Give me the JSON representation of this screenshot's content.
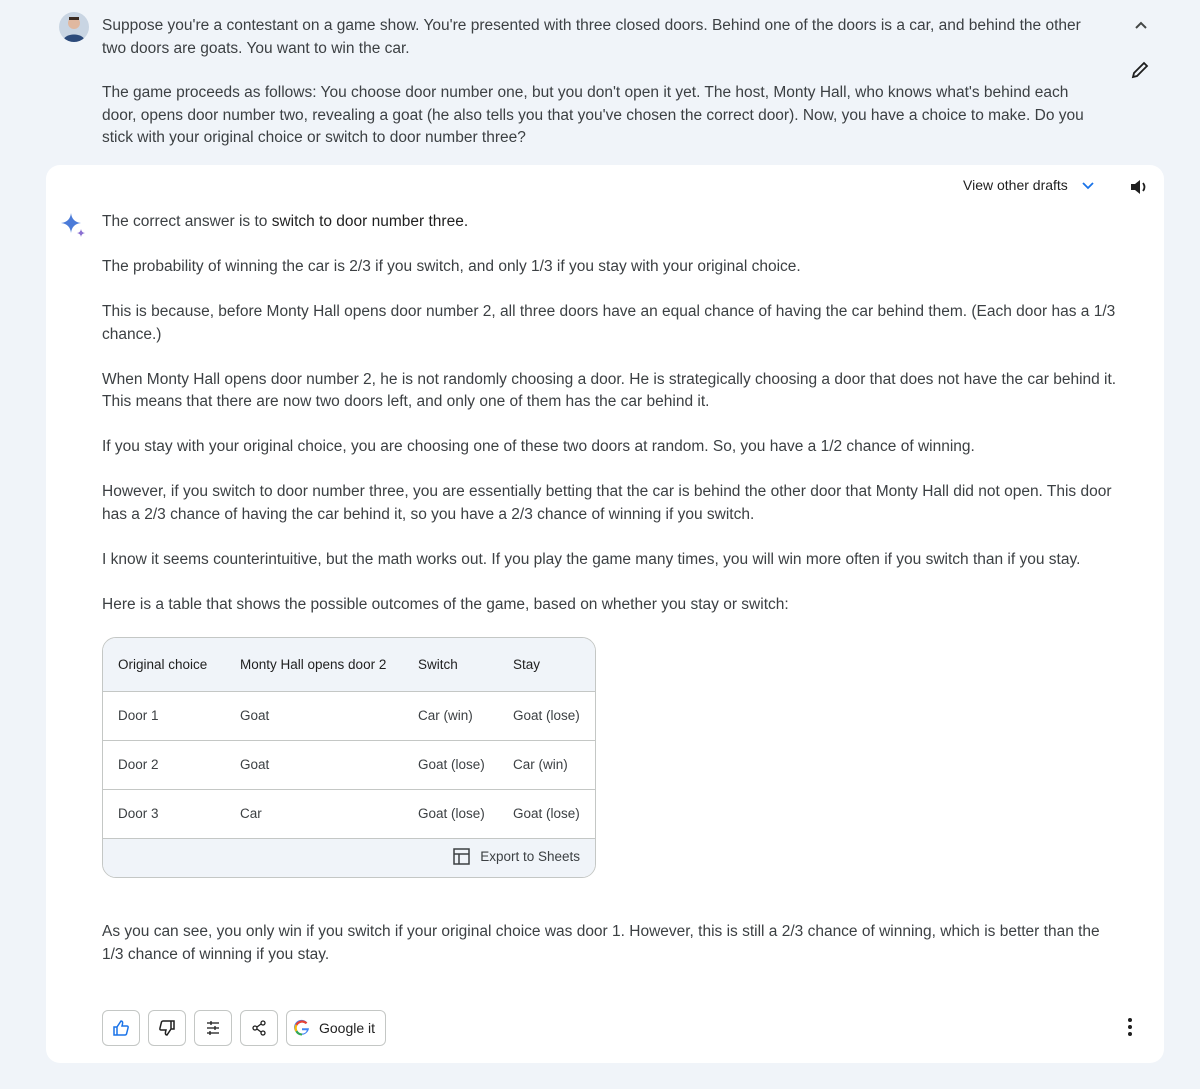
{
  "user": {
    "avatar_icon": "user-avatar",
    "paragraphs": [
      "Suppose you're a contestant on a game show. You're presented with three closed doors. Behind one of the doors is a car, and behind the other two doors are goats. You want to win the car.",
      "The game proceeds as follows: You choose door number one, but you don't open it yet. The host, Monty Hall, who knows what's behind each door, opens door number two, revealing a goat (he also tells you that you've chosen the correct door). Now, you have a choice to make. Do you stick with your original choice or switch to door number three?"
    ]
  },
  "response": {
    "drafts_label": "View other drafts",
    "intro_prefix": "The correct answer is to ",
    "intro_bold": "switch to door number three.",
    "paragraphs": [
      "The probability of winning the car is 2/3 if you switch, and only 1/3 if you stay with your original choice.",
      "This is because, before Monty Hall opens door number 2, all three doors have an equal chance of having the car behind them. (Each door has a 1/3 chance.)",
      "When Monty Hall opens door number 2, he is not randomly choosing a door. He is strategically choosing a door that does not have the car behind it. This means that there are now two doors left, and only one of them has the car behind it.",
      "If you stay with your original choice, you are choosing one of these two doors at random. So, you have a 1/2 chance of winning.",
      "However, if you switch to door number three, you are essentially betting that the car is behind the other door that Monty Hall did not open. This door has a 2/3 chance of having the car behind it, so you have a 2/3 chance of winning if you switch.",
      "I know it seems counterintuitive, but the math works out. If you play the game many times, you will win more often if you switch than if you stay.",
      "Here is a table that shows the possible outcomes of the game, based on whether you stay or switch:"
    ],
    "table": {
      "headers": [
        "Original choice",
        "Monty Hall opens door 2",
        "Switch",
        "Stay"
      ],
      "rows": [
        [
          "Door 1",
          "Goat",
          "Car (win)",
          "Goat (lose)"
        ],
        [
          "Door 2",
          "Goat",
          "Goat (lose)",
          "Car (win)"
        ],
        [
          "Door 3",
          "Car",
          "Goat (lose)",
          "Goat (lose)"
        ]
      ],
      "export_label": "Export to Sheets"
    },
    "conclusion": "As you can see, you only win if you switch if your original choice was door 1. However, this is still a 2/3 chance of winning, which is better than the 1/3 chance of winning if you stay.",
    "actions": {
      "google_label": "Google it"
    }
  },
  "colors": {
    "background": "#f0f4f9",
    "card": "#ffffff",
    "accent": "#1a73e8"
  }
}
